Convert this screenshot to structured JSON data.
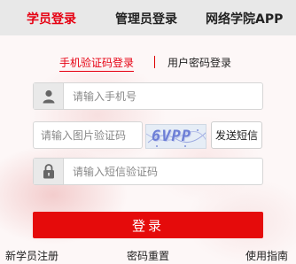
{
  "top_tabs": [
    {
      "label": "学员登录",
      "active": true
    },
    {
      "label": "管理员登录",
      "active": false
    },
    {
      "label": "网络学院APP",
      "active": false
    }
  ],
  "sub_tabs": [
    {
      "label": "手机验证码登录",
      "active": true
    },
    {
      "label": "用户密码登录",
      "active": false
    }
  ],
  "form": {
    "phone_placeholder": "请输入手机号",
    "captcha_placeholder": "请输入图片验证码",
    "captcha_image_text": "6VPP",
    "send_code_label": "发送短信",
    "sms_placeholder": "请输入短信验证码",
    "login_label": "登录"
  },
  "bottom_links": {
    "register": "新学员注册",
    "reset_password": "密码重置",
    "guide": "使用指南"
  },
  "colors": {
    "accent": "#e60012",
    "login_button": "#e50b0b",
    "tab_bar": "#e8e8e8"
  }
}
